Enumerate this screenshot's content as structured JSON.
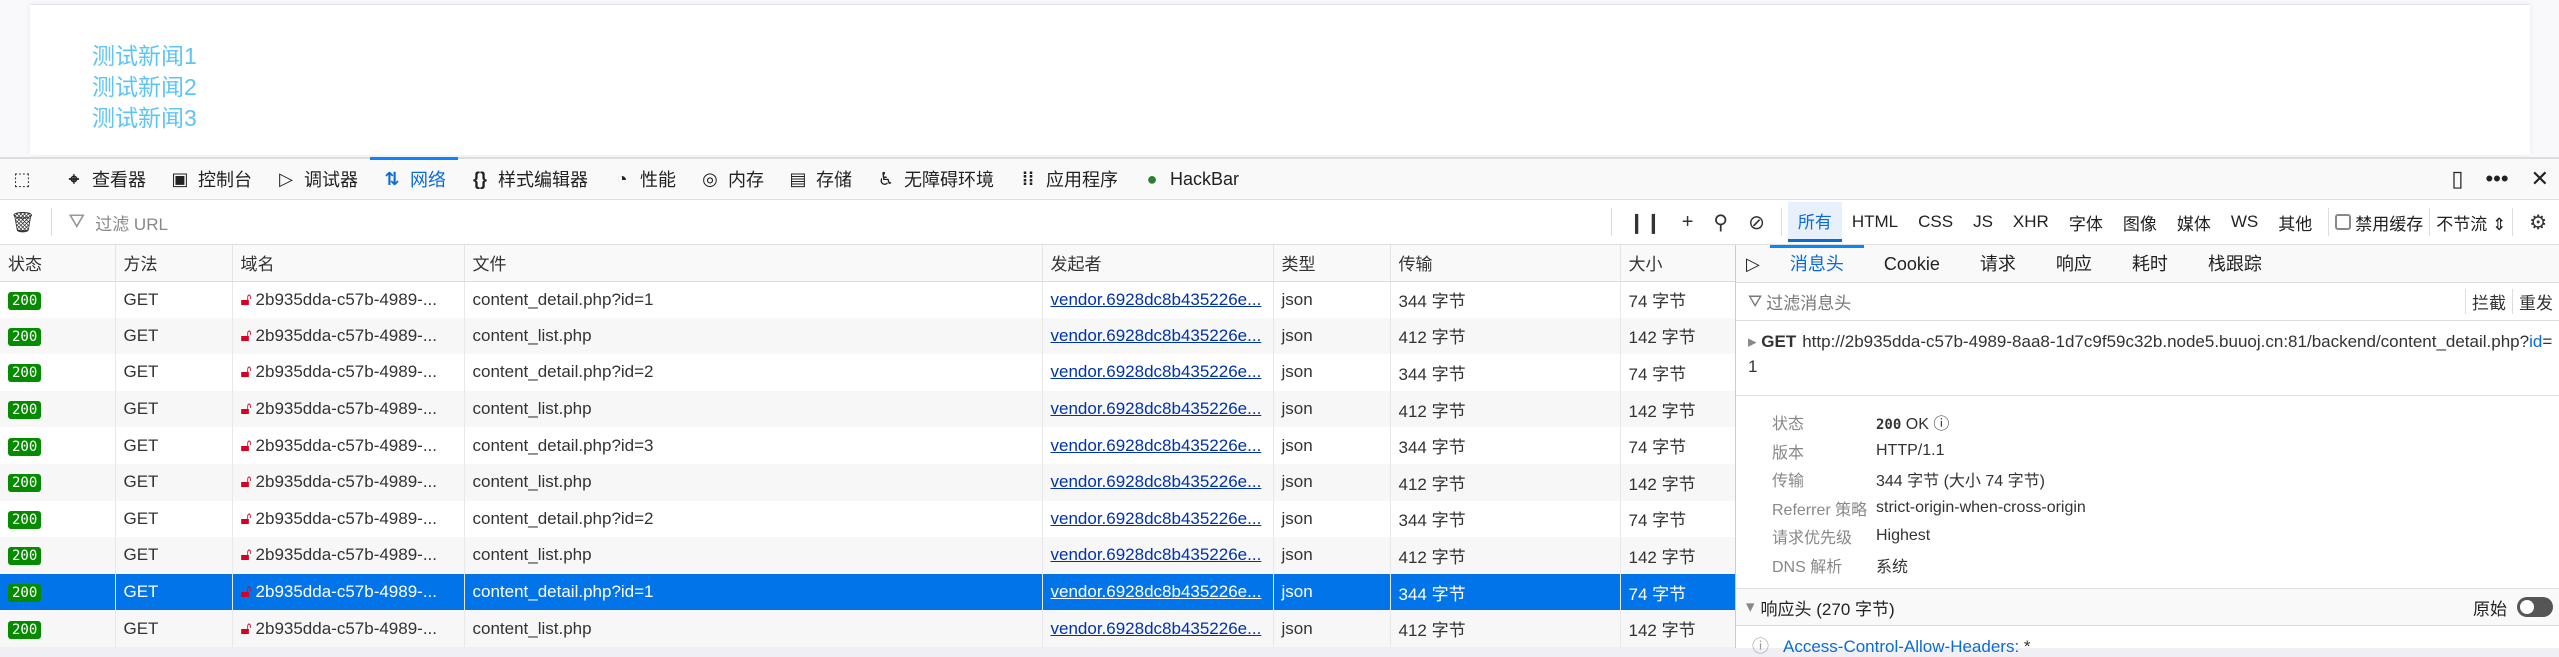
{
  "page": {
    "news": [
      "测试新闻1",
      "测试新闻2",
      "测试新闻3"
    ]
  },
  "toolbar": {
    "tabs": [
      {
        "label": "查看器",
        "icon": "inspector-icon"
      },
      {
        "label": "控制台",
        "icon": "console-icon"
      },
      {
        "label": "调试器",
        "icon": "debugger-icon"
      },
      {
        "label": "网络",
        "icon": "network-icon"
      },
      {
        "label": "样式编辑器",
        "icon": "style-editor-icon"
      },
      {
        "label": "性能",
        "icon": "performance-icon"
      },
      {
        "label": "内存",
        "icon": "memory-icon"
      },
      {
        "label": "存储",
        "icon": "storage-icon"
      },
      {
        "label": "无障碍环境",
        "icon": "accessibility-icon"
      },
      {
        "label": "应用程序",
        "icon": "application-icon"
      },
      {
        "label": "HackBar",
        "icon": "hackbar-icon"
      }
    ],
    "active": "网络"
  },
  "filter": {
    "placeholder": "过滤 URL",
    "types": [
      "所有",
      "HTML",
      "CSS",
      "JS",
      "XHR",
      "字体",
      "图像",
      "媒体",
      "WS",
      "其他"
    ],
    "disable_cache": "禁用缓存",
    "throttle": "不节流"
  },
  "table": {
    "headers": [
      "状态",
      "方法",
      "域名",
      "文件",
      "发起者",
      "类型",
      "传输",
      "大小"
    ],
    "rows": [
      [
        "200",
        "GET",
        "2b935dda-c57b-4989-...",
        "content_detail.php?id=1",
        "vendor.6928dc8b435226e...",
        "json",
        "344 字节",
        "74 字节"
      ],
      [
        "200",
        "GET",
        "2b935dda-c57b-4989-...",
        "content_list.php",
        "vendor.6928dc8b435226e...",
        "json",
        "412 字节",
        "142 字节"
      ],
      [
        "200",
        "GET",
        "2b935dda-c57b-4989-...",
        "content_detail.php?id=2",
        "vendor.6928dc8b435226e...",
        "json",
        "344 字节",
        "74 字节"
      ],
      [
        "200",
        "GET",
        "2b935dda-c57b-4989-...",
        "content_list.php",
        "vendor.6928dc8b435226e...",
        "json",
        "412 字节",
        "142 字节"
      ],
      [
        "200",
        "GET",
        "2b935dda-c57b-4989-...",
        "content_detail.php?id=3",
        "vendor.6928dc8b435226e...",
        "json",
        "344 字节",
        "74 字节"
      ],
      [
        "200",
        "GET",
        "2b935dda-c57b-4989-...",
        "content_list.php",
        "vendor.6928dc8b435226e...",
        "json",
        "412 字节",
        "142 字节"
      ],
      [
        "200",
        "GET",
        "2b935dda-c57b-4989-...",
        "content_detail.php?id=2",
        "vendor.6928dc8b435226e...",
        "json",
        "344 字节",
        "74 字节"
      ],
      [
        "200",
        "GET",
        "2b935dda-c57b-4989-...",
        "content_list.php",
        "vendor.6928dc8b435226e...",
        "json",
        "412 字节",
        "142 字节"
      ],
      [
        "200",
        "GET",
        "2b935dda-c57b-4989-...",
        "content_detail.php?id=1",
        "vendor.6928dc8b435226e...",
        "json",
        "344 字节",
        "74 字节"
      ],
      [
        "200",
        "GET",
        "2b935dda-c57b-4989-...",
        "content_list.php",
        "vendor.6928dc8b435226e...",
        "json",
        "412 字节",
        "142 字节"
      ]
    ],
    "selected_index": 8
  },
  "panel": {
    "tabs": [
      "消息头",
      "Cookie",
      "请求",
      "响应",
      "耗时",
      "栈跟踪"
    ],
    "filter_placeholder": "过滤消息头",
    "block": "拦截",
    "resend": "重发",
    "method": "GET",
    "url_main": "http://2b935dda-c57b-4989-8aa8-1d7c9f59c32b.node5.buuoj.cn:81/backend/content_detail.php?",
    "url_param": "id",
    "url_rest": "=1",
    "details": [
      {
        "k": "状态",
        "v": "OK",
        "code": "200"
      },
      {
        "k": "版本",
        "v": "HTTP/1.1"
      },
      {
        "k": "传输",
        "v": "344 字节 (大小 74 字节)"
      },
      {
        "k": "Referrer 策略",
        "v": "strict-origin-when-cross-origin"
      },
      {
        "k": "请求优先级",
        "v": "Highest"
      },
      {
        "k": "DNS 解析",
        "v": "系统"
      }
    ],
    "response_headers": "响应头 (270 字节)",
    "raw": "原始",
    "first_header": "Access-Control-Allow-Headers:",
    "first_header_value": "*"
  }
}
